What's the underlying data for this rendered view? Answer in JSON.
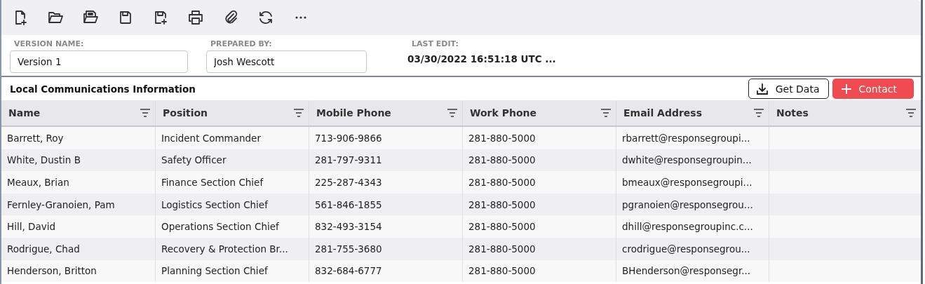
{
  "toolbar": {
    "tools": [
      {
        "kind": "new"
      },
      {
        "kind": "open"
      },
      {
        "kind": "open-docs"
      },
      {
        "kind": "save"
      },
      {
        "kind": "save-add"
      },
      {
        "kind": "print"
      },
      {
        "kind": "attach"
      },
      {
        "kind": "refresh"
      },
      {
        "kind": "more"
      }
    ]
  },
  "form": {
    "version_name": {
      "label": "VERSION NAME:",
      "value": "Version 1"
    },
    "prepared_by": {
      "label": "PREPARED BY:",
      "value": "Josh Wescott"
    },
    "last_edit": {
      "label": "LAST EDIT:",
      "value": "03/30/2022 16:51:18 UTC ..."
    }
  },
  "section": {
    "title": "Local Communications Information",
    "buttons": [
      {
        "kind": "download",
        "label": "Get Data"
      },
      {
        "kind": "add",
        "label": "Contact"
      }
    ]
  },
  "table": {
    "columns": [
      "Name",
      "Position",
      "Mobile Phone",
      "Work Phone",
      "Email Address",
      "Notes"
    ],
    "rows": [
      [
        "Barrett, Roy",
        "Incident Commander",
        "713-906-9866",
        "281-880-5000",
        "rbarrett@responsegroupi..."
      ],
      [
        "White, Dustin B",
        "Safety Officer",
        "281-797-9311",
        "281-880-5000",
        "dwhite@responsegroupin..."
      ],
      [
        "Meaux, Brian",
        "Finance Section Chief",
        "225-287-4343",
        "281-880-5000",
        "bmeaux@responsegroupi..."
      ],
      [
        "Fernley-Granoien, Pam",
        "Logistics Section Chief",
        "561-846-1855",
        "281-880-5000",
        "pgranoien@responsegrou..."
      ],
      [
        "Hill, David",
        "Operations Section Chief",
        "832-493-3154",
        "281-880-5000",
        "dhill@responsegroupinc.c..."
      ],
      [
        "Rodrigue, Chad",
        "Recovery & Protection Br...",
        "281-755-3680",
        "281-880-5000",
        "crodrigue@responsegrou..."
      ],
      [
        "Henderson, Britton",
        "Planning Section Chief",
        "832-684-6777",
        "281-880-5000",
        "BHenderson@responsegr..."
      ]
    ]
  }
}
